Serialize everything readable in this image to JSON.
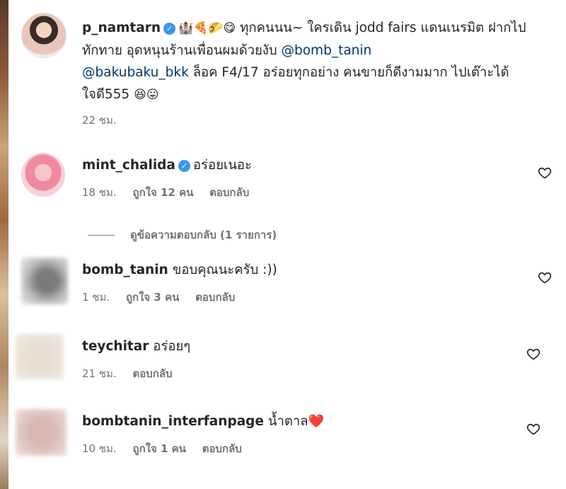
{
  "post": {
    "username": "p_namtarn",
    "emojis": "🏰🍕🌮😋",
    "text_part1": " ทุกคนนน~ ใครเดิน jodd fairs แดนเนรมิต ฝากไปทักทาย อุดหนุนร้านเพื่อนผมด้วยงับ ",
    "mention1": "@bomb_tanin",
    "mention2": "@bakubaku_bkk",
    "text_part2": " ล็อค F4/17 อร่อยทุกอย่าง คนขายก็ดีงามมาก ไปเต๊าะได้ ใจดี555 ",
    "text_emojis": "😆😛",
    "time": "22 ชม."
  },
  "comments": [
    {
      "username": "mint_chalida",
      "verified": true,
      "text": "อร่อยเนอะ",
      "time": "18 ชม.",
      "likes": "ถูกใจ 12 คน",
      "reply": "ตอบกลับ"
    },
    {
      "username": "bomb_tanin",
      "text": "ขอบคุณนะครับ :))",
      "time": "1 ชม.",
      "likes": "ถูกใจ 3 คน",
      "reply": "ตอบกลับ"
    },
    {
      "username": "teychitar",
      "text": "อร่อยๆ",
      "time": "21 ชม.",
      "reply": "ตอบกลับ"
    },
    {
      "username": "bombtanin_interfanpage",
      "text": "น้ำตาล",
      "emoji": "❤️",
      "time": "10 ชม.",
      "likes": "ถูกใจ 1 คน",
      "reply": "ตอบกลับ"
    }
  ],
  "view_replies": "ดูข้อความตอบกลับ (1 รายการ)",
  "icons": {
    "verified": "verified-badge-icon",
    "like": "heart-outline-icon"
  },
  "colors": {
    "verified": "#3897f0",
    "mention": "#00376b",
    "meta": "#737373",
    "heart_red": "#ed4956"
  }
}
